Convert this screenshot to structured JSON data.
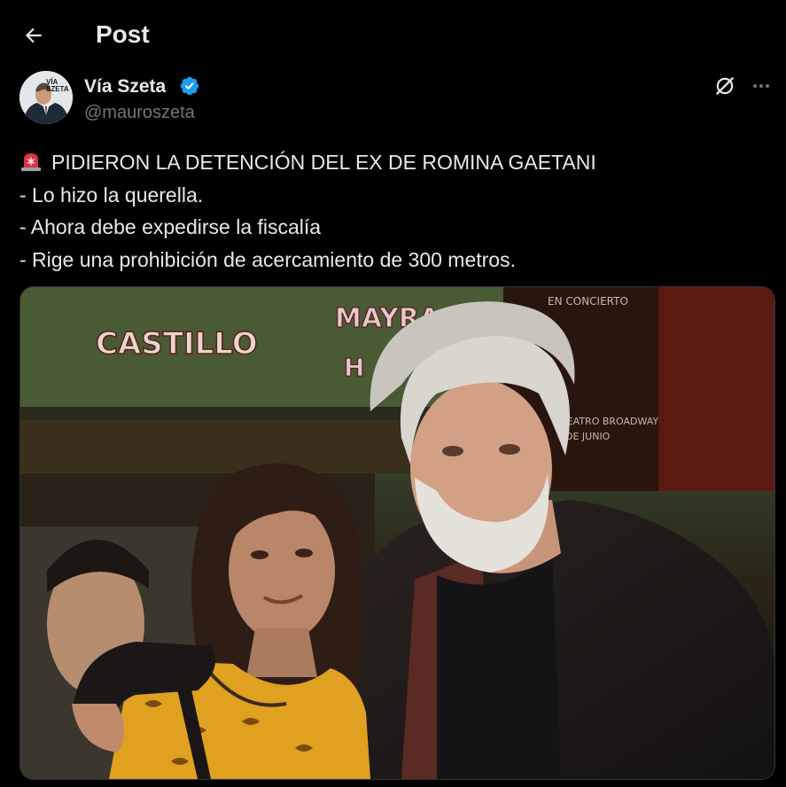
{
  "header": {
    "back_icon": "arrow-left-icon",
    "title": "Post"
  },
  "author": {
    "avatar_text": "VÍA SZETA",
    "display_name": "Vía Szeta",
    "verified_icon": "verified-badge-icon",
    "verified_color": "#1d9bf0",
    "handle": "@mauroszeta",
    "grok_icon": "grok-icon",
    "more_icon": "more-horizontal-icon"
  },
  "tweet": {
    "lines": [
      "PIDIERON LA DETENCIÓN DEL EX DE ROMINA GAETANI",
      "- Lo hizo la querella.",
      "- Ahora debe expedirse la fiscalía",
      "- Rige una prohibición de acercamiento de 300 metros."
    ],
    "lead_icon": "siren-icon"
  },
  "media": {
    "sign_left": "CASTILLO",
    "sign_mid_1": "MAYRA",
    "sign_mid_2": "H",
    "sign_right_1": "EN CONCIERTO",
    "sign_right_2": "TEATRO BROADWAY",
    "sign_right_3": "DE JUNIO"
  },
  "colors": {
    "background": "#000000",
    "text_primary": "#e7e9ea",
    "text_secondary": "#71767b",
    "accent": "#1d9bf0"
  }
}
